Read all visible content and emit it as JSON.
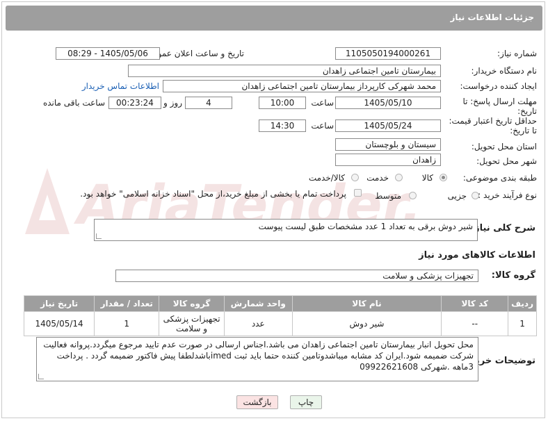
{
  "page": {
    "title": "جزئیات اطلاعات نیاز"
  },
  "watermark": {
    "text": "AriaTender.net"
  },
  "fields": {
    "need_number": {
      "label": "شماره نیاز:",
      "value": "1105050194000261"
    },
    "announce_datetime": {
      "label": "تاریخ و ساعت اعلان عمومی:",
      "value": "1405/05/06 - 08:29"
    },
    "buyer_org": {
      "label": "نام دستگاه خریدار:",
      "value": "بیمارستان تامین اجتماعی زاهدان"
    },
    "requester": {
      "label": "ایجاد کننده درخواست:",
      "value": "محمد شهرکی کارپرداز بیمارستان تامین اجتماعی زاهدان",
      "contact_link": "اطلاعات تماس خریدار"
    },
    "reply_deadline": {
      "label_line1": "مهلت ارسال پاسخ: تا",
      "label_line2": "تاریخ:",
      "date": "1405/05/10",
      "time_label": "ساعت",
      "time": "10:00",
      "days": "4",
      "days_label": "روز و",
      "remaining": "00:23:24",
      "remaining_label": "ساعت باقی مانده"
    },
    "price_validity": {
      "label_line1": "حداقل تاریخ اعتبار قیمت:",
      "label_line2": "تا تاریخ:",
      "date": "1405/05/24",
      "time_label": "ساعت",
      "time": "14:30"
    },
    "province": {
      "label": "استان محل تحویل:",
      "value": "سیستان و بلوچستان"
    },
    "city": {
      "label": "شهر محل تحویل:",
      "value": "زاهدان"
    },
    "category": {
      "label": "طبقه بندی موضوعی:",
      "options": [
        {
          "label": "کالا",
          "checked": true
        },
        {
          "label": "خدمت",
          "checked": false
        },
        {
          "label": "کالا/خدمت",
          "checked": false
        }
      ]
    },
    "process_type": {
      "label": "نوع فرآیند خرید :",
      "options": [
        {
          "label": "جزیی",
          "checked": false
        },
        {
          "label": "متوسط",
          "checked": false
        }
      ],
      "payment_note": "پرداخت تمام یا بخشی از مبلغ خرید،از محل \"اسناد خزانه اسلامی\" خواهد بود."
    },
    "summary": {
      "label": "شرح کلی نیاز:",
      "value": "شیر دوش برقی به تعداد 1 عدد مشخصات طبق لیست پیوست"
    }
  },
  "goods": {
    "section_title": "اطلاعات کالاهای مورد نیاز",
    "group_label": "گروه کالا:",
    "group_value": "تجهیزات پزشکی و سلامت",
    "columns": [
      "ردیف",
      "کد کالا",
      "نام کالا",
      "واحد شمارش",
      "گروه کالا",
      "تعداد / مقدار",
      "تاریخ نیاز"
    ],
    "rows": [
      {
        "row": "1",
        "code": "--",
        "name": "شیر دوش",
        "unit": "عدد",
        "group": "تجهیزات پزشکی و سلامت",
        "qty": "1",
        "date": "1405/05/14"
      }
    ]
  },
  "buyer_notes": {
    "label": "توضیحات خریدار:",
    "text": "محل تحویل انبار بیمارستان تامین اجتماعی زاهدان می باشد.اجناس ارسالی در صورت عدم تایید مرجوع میگردد.پروانه فعالیت شرکت ضمیمه شود.ایران کد مشابه میباشدوتامین کننده حتما باید ثبت imedباشدلطفا پیش فاکتور ضمیمه گردد . پرداخت 3ماهه  .شهرکی 09922621608"
  },
  "buttons": {
    "print": "چاپ",
    "back": "بازگشت"
  },
  "colors": {
    "header": "#9e9e9e",
    "link": "#1a5fb4",
    "print_bg": "#eaf5ea",
    "back_bg": "#fbe3e3"
  }
}
